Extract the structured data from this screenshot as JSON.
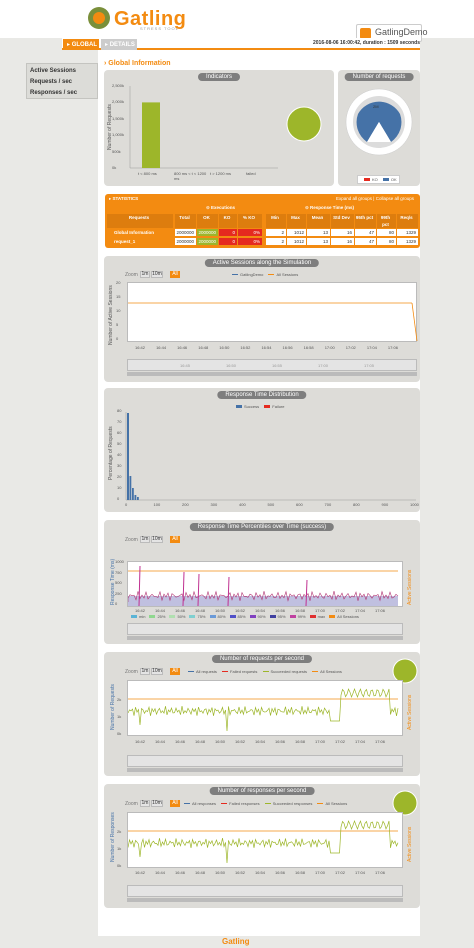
{
  "header": {
    "logo_text": "Gatling",
    "logo_sub": "STRESS TOOL",
    "simulation": "GatlingDemo",
    "run_info": "2016-08-06 16:00:42, duration : 1509 seconds"
  },
  "tabs": [
    {
      "label": "GLOBAL",
      "active": true
    },
    {
      "label": "DETAILS",
      "active": false
    }
  ],
  "sidebar": {
    "items": [
      {
        "label": "Active Sessions"
      },
      {
        "label": "Requests / sec"
      },
      {
        "label": "Responses / sec"
      }
    ]
  },
  "section_title": "Global Information",
  "indicators": {
    "title": "Indicators",
    "ylabel": "Number of Requests",
    "yticks": [
      "2,500k",
      "2,000k",
      "1,500k",
      "1,000k",
      "500k",
      "0k"
    ],
    "categories": [
      "t < 800 ms",
      "800 ms < t < 1200 ms",
      "t > 1200 ms",
      "failed"
    ],
    "values": [
      2000000,
      0,
      0,
      0
    ]
  },
  "requests_pie": {
    "title": "Number of requests",
    "center_label": "2M",
    "legend": [
      "KO",
      "OK"
    ]
  },
  "stats": {
    "title": "STATISTICS",
    "expand_text": "Expand all groups | Collapse all groups",
    "group_exec": "Executions",
    "group_rt": "Response Time (ms)",
    "columns": [
      "Requests",
      "Total",
      "OK",
      "KO",
      "% KO",
      "Min",
      "Max",
      "Mean",
      "Std Dev",
      "95th pct",
      "99th pct",
      "Req/s"
    ],
    "rows": [
      {
        "name": "Global Information",
        "cells": [
          "2000000",
          "2000000",
          "0",
          "0%",
          "2",
          "1012",
          "13",
          "16",
          "47",
          "80",
          "1329"
        ]
      },
      {
        "name": "request_1",
        "cells": [
          "2000000",
          "2000000",
          "0",
          "0%",
          "2",
          "1012",
          "13",
          "16",
          "47",
          "80",
          "1329"
        ]
      }
    ]
  },
  "time_ticks": [
    "16:42",
    "16:44",
    "16:46",
    "16:48",
    "16:50",
    "16:52",
    "16:54",
    "16:56",
    "16:58",
    "17:00",
    "17:02",
    "17:04",
    "17:06"
  ],
  "zoom": {
    "label": "Zoom",
    "buttons": [
      "1m",
      "10m",
      "All"
    ]
  },
  "active_sessions": {
    "title": "Active Sessions along the Simulation",
    "ylabel": "Number of Active Sessions",
    "yticks": [
      "20",
      "15",
      "10",
      "5",
      "0"
    ],
    "legend": [
      "GatlingDemo",
      "All Sessions"
    ],
    "nav_ticks": [
      "16:45",
      "16:50",
      "16:55",
      "17:00",
      "17:05"
    ]
  },
  "rt_distribution": {
    "title": "Response Time Distribution",
    "ylabel": "Percentage of Requests",
    "yticks": [
      "80",
      "70",
      "60",
      "50",
      "40",
      "30",
      "20",
      "10",
      "0"
    ],
    "xticks": [
      "0",
      "100",
      "200",
      "300",
      "400",
      "500",
      "600",
      "700",
      "800",
      "900",
      "1000"
    ],
    "legend": [
      "Success",
      "Failure"
    ]
  },
  "rt_percentiles": {
    "title": "Response Time Percentiles over Time (success)",
    "ylabel": "Response Time (ms)",
    "y2label": "Active Sessions",
    "yticks": [
      "1000",
      "750",
      "500",
      "250",
      "0"
    ],
    "legend": [
      "min",
      "25%",
      "50%",
      "75%",
      "80%",
      "85%",
      "90%",
      "95%",
      "99%",
      "max",
      "All Sessions"
    ]
  },
  "requests_per_sec": {
    "title": "Number of requests per second",
    "ylabel": "Number of Requests",
    "y2label": "Active Sessions",
    "yticks": [
      "2k",
      "1k",
      "0k"
    ],
    "legend": [
      "All requests",
      "Failed requests",
      "Succeeded requests",
      "All Sessions"
    ]
  },
  "responses_per_sec": {
    "title": "Number of responses per second",
    "ylabel": "Number of Responses",
    "y2label": "Active Sessions",
    "yticks": [
      "2k",
      "1k",
      "0k"
    ],
    "legend": [
      "All responses",
      "Failed responses",
      "Succeeded responses",
      "All Sessions"
    ]
  },
  "footer": {
    "text": "Gatling"
  },
  "colors": {
    "accent": "#f38b11",
    "ok": "#9db62a",
    "ko": "#e52a1f",
    "blue": "#4572a7",
    "panel": "#dddcd8"
  }
}
